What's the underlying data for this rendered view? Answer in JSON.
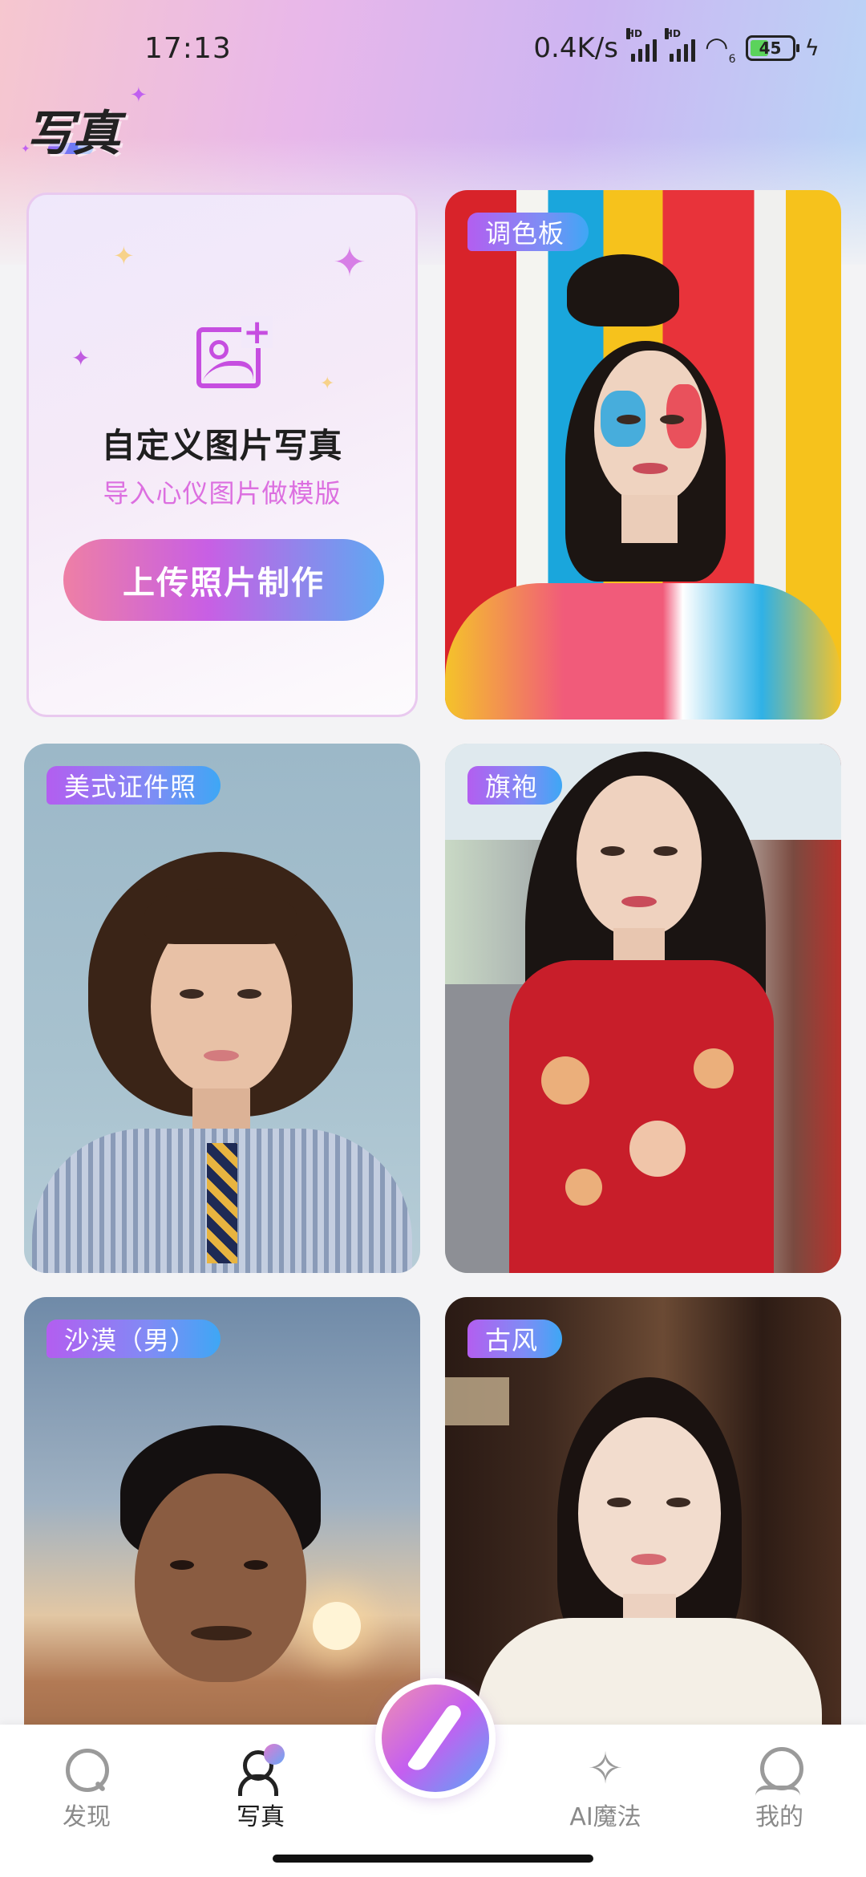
{
  "status_bar": {
    "time": "17:13",
    "network_speed": "0.4K/s",
    "sim1_label": "HD",
    "sim2_label": "HD",
    "wifi_label": "6",
    "battery": "45"
  },
  "header": {
    "logo_text": "写真"
  },
  "create_card": {
    "title": "自定义图片写真",
    "subtitle": "导入心仪图片做模版",
    "button_label": "上传照片制作"
  },
  "styles": [
    {
      "tag": "调色板"
    },
    {
      "tag": "美式证件照"
    },
    {
      "tag": "旗袍"
    },
    {
      "tag": "沙漠（男）"
    },
    {
      "tag": "古风"
    }
  ],
  "bottom_nav": {
    "items": [
      {
        "label": "发现",
        "icon": "search-icon"
      },
      {
        "label": "写真",
        "icon": "person-icon"
      },
      {
        "label": "AI魔法",
        "icon": "magic-wand-icon"
      },
      {
        "label": "我的",
        "icon": "profile-icon"
      }
    ],
    "center_button_icon": "brush-icon"
  },
  "colors": {
    "accent_gradient_start": "#ee7fa5",
    "accent_gradient_mid": "#c85fe4",
    "accent_gradient_end": "#5ea8f2",
    "subtitle_pink": "#dc6fe0"
  }
}
